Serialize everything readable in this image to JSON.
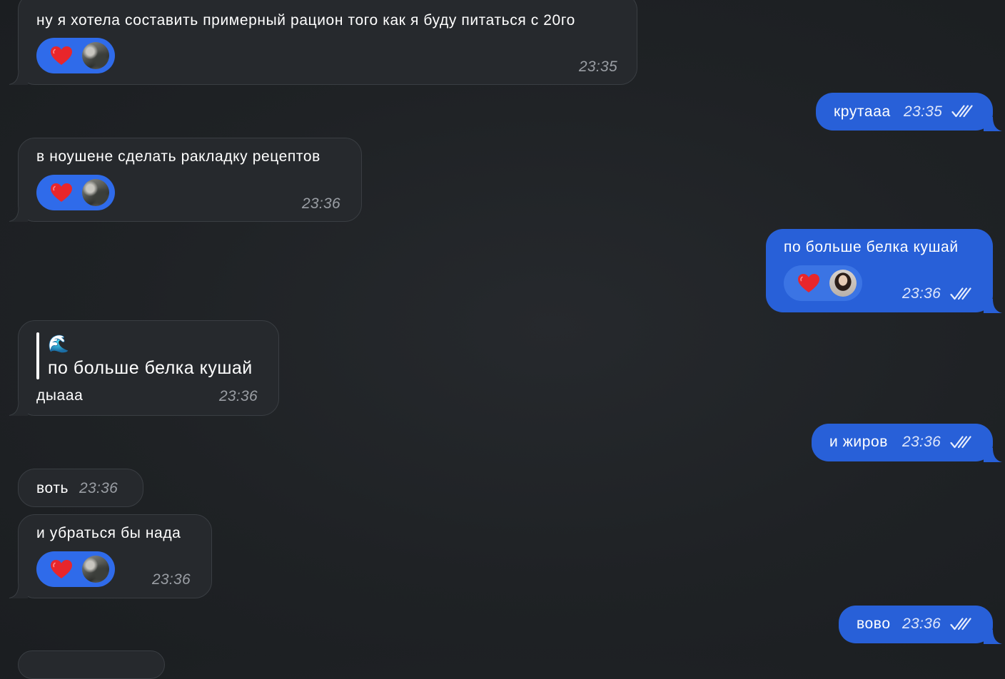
{
  "colors": {
    "background": "#1f2225",
    "incoming_bubble": "#26292d",
    "outgoing_bubble": "#2860d8",
    "reaction_pill": "#2f6bea",
    "heart": "#e8262b"
  },
  "messages": [
    {
      "direction": "in",
      "text": "ну я хотела составить примерный рацион того как я буду питаться с 20го",
      "time": "23:35",
      "reaction": "heart"
    },
    {
      "direction": "out",
      "text": "крутааа",
      "time": "23:35",
      "status": "read"
    },
    {
      "direction": "in",
      "text": "в ноушене сделать ракладку рецептов",
      "time": "23:36",
      "reaction": "heart"
    },
    {
      "direction": "out",
      "text": "по больше белка кушай",
      "time": "23:36",
      "status": "read",
      "reaction": "heart"
    },
    {
      "direction": "in",
      "reply": {
        "emoji": "🌊",
        "quoted_text": "по больше белка кушай"
      },
      "text": "дыааа",
      "time": "23:36"
    },
    {
      "direction": "out",
      "text": "и жиров",
      "time": "23:36",
      "status": "read"
    },
    {
      "direction": "in",
      "text": "воть",
      "time": "23:36"
    },
    {
      "direction": "in",
      "text": "и убраться бы нада",
      "time": "23:36",
      "reaction": "heart"
    },
    {
      "direction": "out",
      "text": "вово",
      "time": "23:36",
      "status": "read"
    }
  ]
}
